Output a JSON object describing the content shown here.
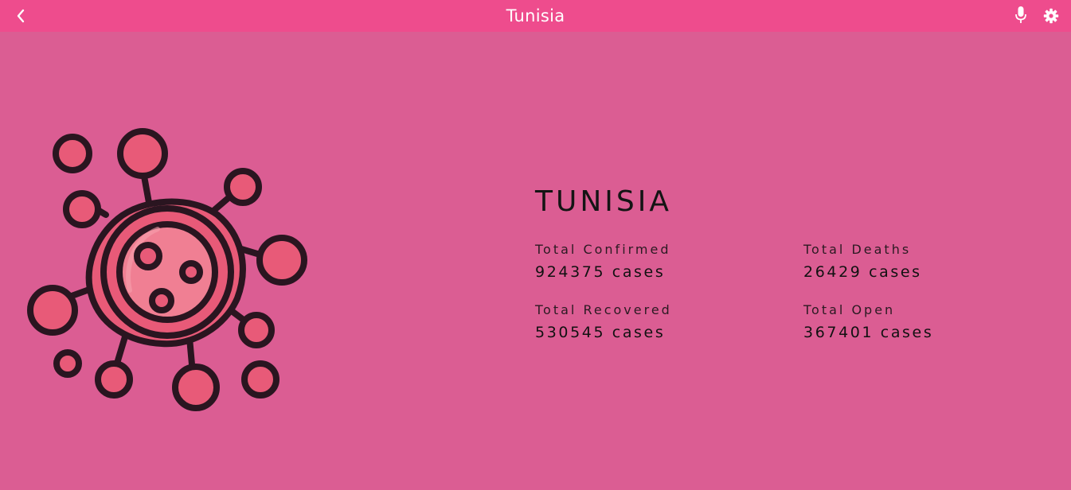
{
  "header": {
    "title": "Tunisia",
    "icons": [
      "chevron-left-icon",
      "microphone-icon",
      "gear-icon"
    ]
  },
  "colors": {
    "header_bg": "#ee4c8d",
    "page_bg": "#db5d93",
    "virus_fill": "#e85a78",
    "virus_core": "#f07f93",
    "outline": "#2a1520"
  },
  "main": {
    "country": "TUNISIA",
    "stats": [
      {
        "label": "Total Confirmed",
        "value": "924375 cases"
      },
      {
        "label": "Total Deaths",
        "value": "26429 cases"
      },
      {
        "label": "Total Recovered",
        "value": "530545 cases"
      },
      {
        "label": "Total Open",
        "value": "367401 cases"
      }
    ]
  }
}
